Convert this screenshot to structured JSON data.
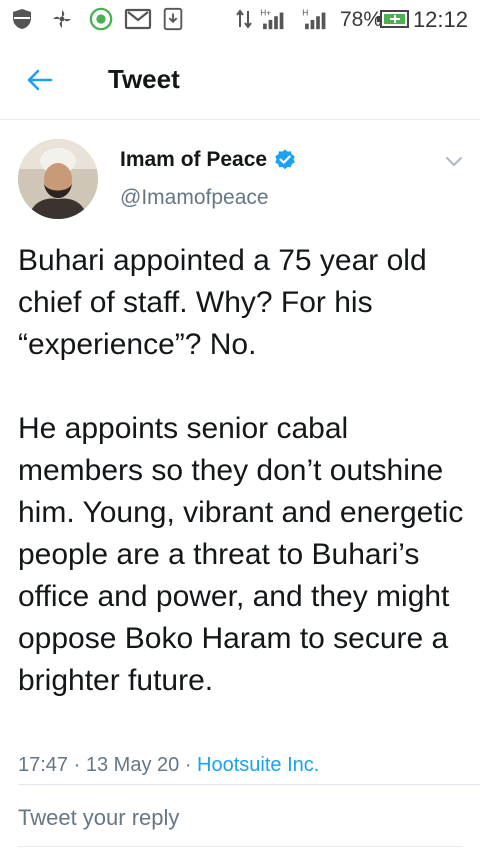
{
  "status_bar": {
    "battery": "78%",
    "time": "12:12",
    "network": "H+"
  },
  "app_bar": {
    "title": "Tweet"
  },
  "tweet": {
    "display_name": "Imam of Peace",
    "handle": "@Imamofpeace",
    "text": "Buhari appointed a 75 year old chief of staff. Why? For his “experience”? No.\n\nHe appoints senior cabal members so they don’t outshine him. Young, vibrant and energetic people are a threat to Buhari’s office and power, and they might oppose Boko Haram to secure a brighter future.",
    "time": "17:47",
    "date": "13 May 20",
    "separator": "·",
    "source": "Hootsuite Inc."
  },
  "reply": {
    "placeholder": "Tweet your reply"
  },
  "colors": {
    "accent": "#1da1f2",
    "muted": "#657786",
    "text": "#14171a"
  }
}
